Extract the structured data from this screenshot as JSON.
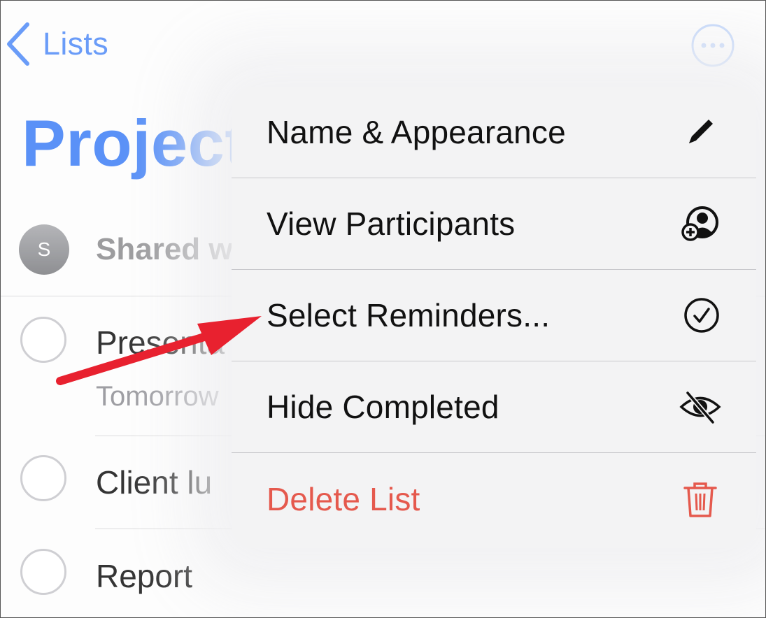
{
  "nav": {
    "back_label": "Lists",
    "back_icon": "chevron-left-icon",
    "more_icon": "ellipsis-circle-icon"
  },
  "list": {
    "title": "Project",
    "shared_avatar_initial": "S",
    "shared_text": "Shared w",
    "tasks": [
      {
        "title": "Presenta",
        "subtitle": "Tomorrow"
      },
      {
        "title": "Client lu"
      },
      {
        "title": "Report"
      }
    ]
  },
  "menu": {
    "items": [
      {
        "label": "Name & Appearance",
        "icon": "pencil-icon"
      },
      {
        "label": "View Participants",
        "icon": "person-add-icon"
      },
      {
        "label": "Select Reminders...",
        "icon": "checkmark-circle-icon"
      },
      {
        "label": "Hide Completed",
        "icon": "eye-slash-icon"
      },
      {
        "label": "Delete List",
        "icon": "trash-icon"
      }
    ]
  },
  "colors": {
    "accent": "#3478f6",
    "destructive": "#e5594d",
    "annotation_arrow": "#e8212f"
  }
}
